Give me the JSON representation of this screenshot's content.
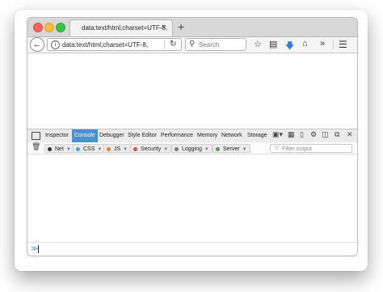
{
  "browser": {
    "tab_title": "data:text/html;charset=UTF-8,",
    "tab_close": "×",
    "new_tab": "+",
    "url": "data:text/html;charset=UTF-8,",
    "search_placeholder": "Search"
  },
  "devtools": {
    "tabs": [
      "Inspector",
      "Console",
      "Debugger",
      "Style Editor",
      "Performance",
      "Memory",
      "Network",
      "Storage"
    ],
    "selected_tab": "Console",
    "filters": [
      {
        "label": "Net",
        "color": "#333333"
      },
      {
        "label": "CSS",
        "color": "#4aa3df"
      },
      {
        "label": "JS",
        "color": "#e8822a"
      },
      {
        "label": "Security",
        "color": "#e04b3f"
      },
      {
        "label": "Logging",
        "color": "#7a7a7a"
      },
      {
        "label": "Server",
        "color": "#5a9f3f"
      }
    ],
    "filter_output_placeholder": "Filter output",
    "input_prompt": "≫"
  }
}
